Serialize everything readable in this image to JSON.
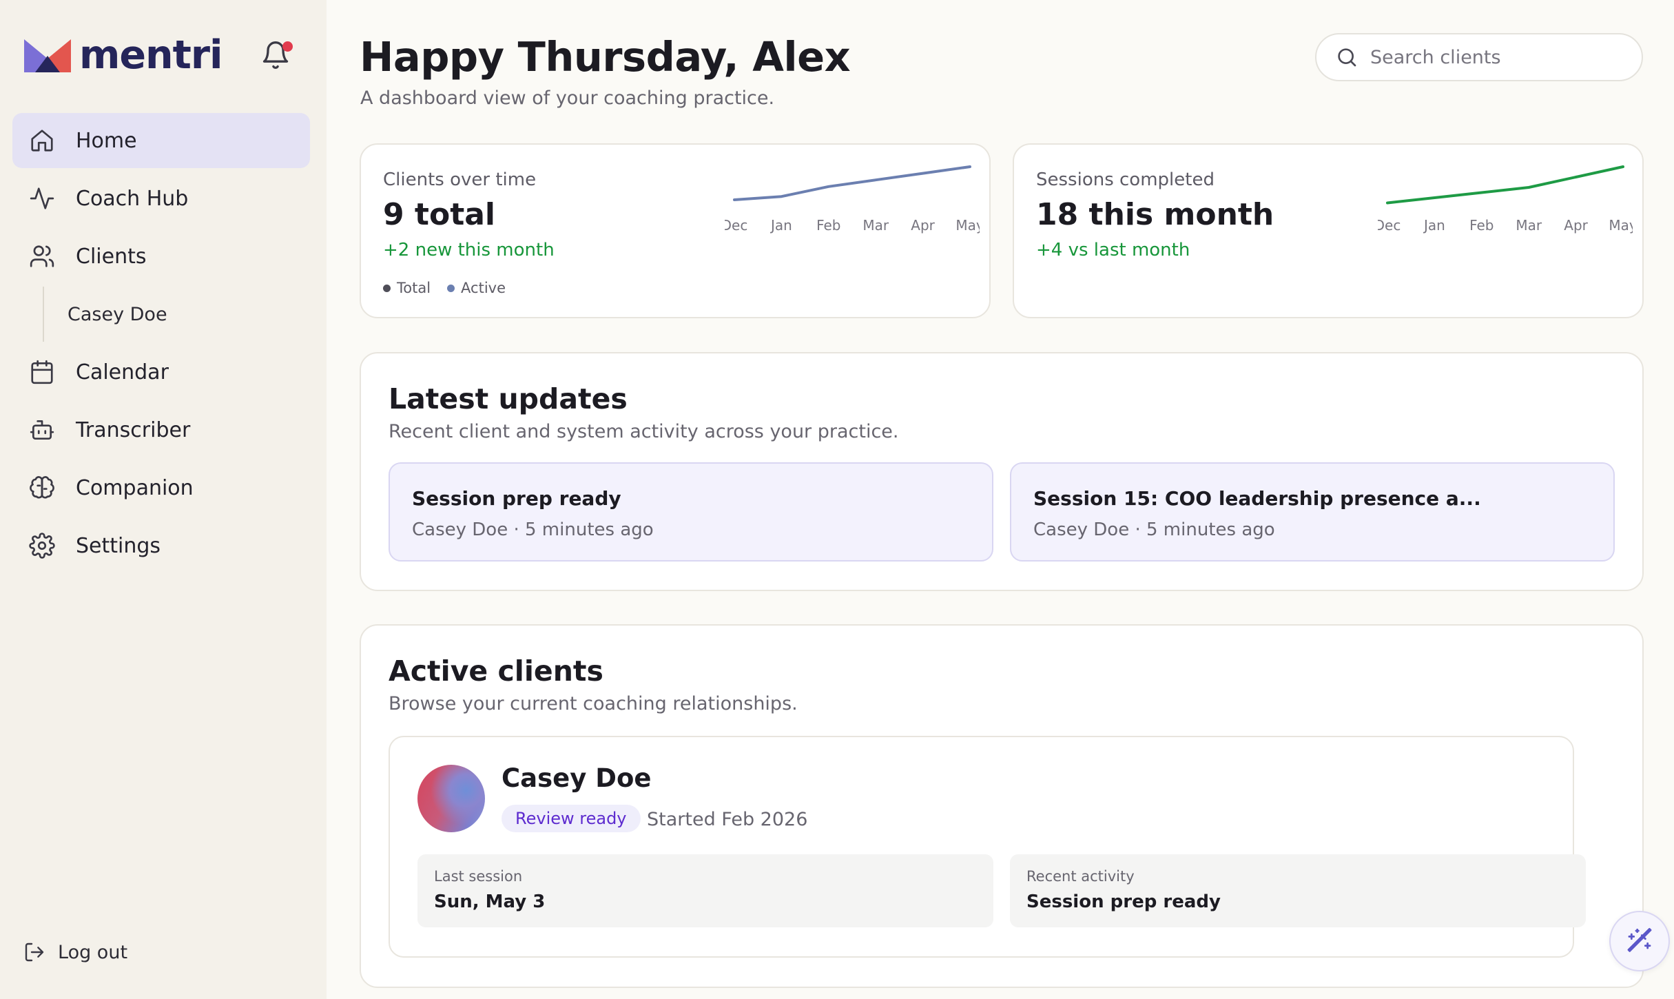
{
  "app": {
    "name": "mentri"
  },
  "colors": {
    "accent": "#5d2bcf",
    "positive": "#17963a",
    "chart_blue": "#6b7fb0",
    "chart_green": "#1e9b45",
    "notification": "#e13b4d"
  },
  "sidebar": {
    "items": [
      {
        "label": "Home",
        "icon": "home-icon",
        "active": true
      },
      {
        "label": "Coach Hub",
        "icon": "activity-icon"
      },
      {
        "label": "Clients",
        "icon": "users-icon"
      },
      {
        "label": "Casey Doe",
        "sub": true
      },
      {
        "label": "Calendar",
        "icon": "calendar-icon"
      },
      {
        "label": "Transcriber",
        "icon": "bot-icon"
      },
      {
        "label": "Companion",
        "icon": "brain-icon"
      },
      {
        "label": "Settings",
        "icon": "gear-icon"
      }
    ],
    "logout_label": "Log out"
  },
  "header": {
    "greeting": "Happy Thursday, Alex",
    "subtitle": "A dashboard view of your coaching practice.",
    "search_placeholder": "Search clients"
  },
  "stats": {
    "clients": {
      "label": "Clients over time",
      "value": "9 total",
      "delta": "+2 new this month",
      "legend": [
        "Total",
        "Active"
      ]
    },
    "sessions": {
      "label": "Sessions completed",
      "value": "18 this month",
      "delta": "+4 vs last month"
    }
  },
  "chart_data": [
    {
      "type": "line",
      "x": [
        "Dec",
        "Jan",
        "Feb",
        "Mar",
        "Apr",
        "May"
      ],
      "series": [
        {
          "name": "Total",
          "values": [
            7,
            7.2,
            7.8,
            8.2,
            8.6,
            9
          ]
        }
      ],
      "ylim": [
        6.5,
        9
      ],
      "grid": false
    },
    {
      "type": "line",
      "x": [
        "Dec",
        "Jan",
        "Feb",
        "Mar",
        "Apr",
        "May"
      ],
      "series": [
        {
          "values": [
            11,
            12,
            13,
            14,
            16,
            18
          ]
        }
      ],
      "ylim": [
        10,
        18
      ],
      "grid": false
    }
  ],
  "updates": {
    "title": "Latest updates",
    "subtitle": "Recent client and system activity across your practice.",
    "items": [
      {
        "title": "Session prep ready",
        "meta": "Casey Doe · 5 minutes ago"
      },
      {
        "title": "Session 15: COO leadership presence a...",
        "meta": "Casey Doe · 5 minutes ago"
      }
    ]
  },
  "active_clients": {
    "title": "Active clients",
    "subtitle": "Browse your current coaching relationships.",
    "clients": [
      {
        "name": "Casey Doe",
        "badge": "Review ready",
        "started": "Started Feb 2026",
        "last_session_label": "Last session",
        "last_session_value": "Sun, May 3",
        "recent_activity_label": "Recent activity",
        "recent_activity_value": "Session prep ready"
      }
    ]
  }
}
